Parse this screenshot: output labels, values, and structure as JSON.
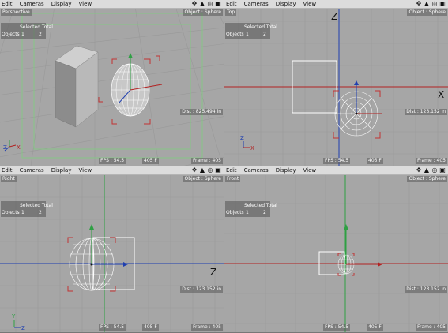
{
  "menu": [
    "Edit",
    "Cameras",
    "Display",
    "View"
  ],
  "nav_icons": [
    "move-icon",
    "rotate-icon",
    "zoom-icon",
    "maximize-icon"
  ],
  "panes": [
    {
      "view": "Perspective",
      "object": "Object : Sphere",
      "selected_total": "Selected Total",
      "objects_label": "Objects",
      "objects_selected": "1",
      "objects_total": "2",
      "dist": "Dist : 825.494 in",
      "fps": "FPS : 54.5",
      "frames": "405 F",
      "frame": "Frame : 405"
    },
    {
      "view": "Top",
      "object": "Object : Sphere",
      "selected_total": "Selected Total",
      "objects_label": "Objects",
      "objects_selected": "1",
      "objects_total": "2",
      "dist": "Dist : 123.152 in",
      "fps": "FPS : 54.5",
      "frames": "405 F",
      "frame": "Frame : 405",
      "axis_labels": [
        "Z",
        "X"
      ]
    },
    {
      "view": "Right",
      "object": "Object : Sphere",
      "selected_total": "Selected Total",
      "objects_label": "Objects",
      "objects_selected": "1",
      "objects_total": "2",
      "dist": "Dist : 123.152 in",
      "fps": "FPS : 54.5",
      "frames": "405 F",
      "frame": "Frame : 405",
      "axis_labels": [
        "Z",
        "Y"
      ]
    },
    {
      "view": "Front",
      "object": "Object : Sphere",
      "selected_total": "Selected Total",
      "objects_label": "Objects",
      "objects_selected": "1",
      "objects_total": "2",
      "dist": "Dist : 123.152 in",
      "fps": "FPS : 54.5",
      "frames": "405 F",
      "frame": "Frame : 405"
    }
  ],
  "colors": {
    "viewport_bg": "#a6a6a6",
    "grid": "#999999",
    "axis_red": "#b22222",
    "axis_blue": "#1f3fb0",
    "axis_green": "#2ea043",
    "safe_frame": "#7fd07f",
    "bbox_corner": "#c33333"
  }
}
